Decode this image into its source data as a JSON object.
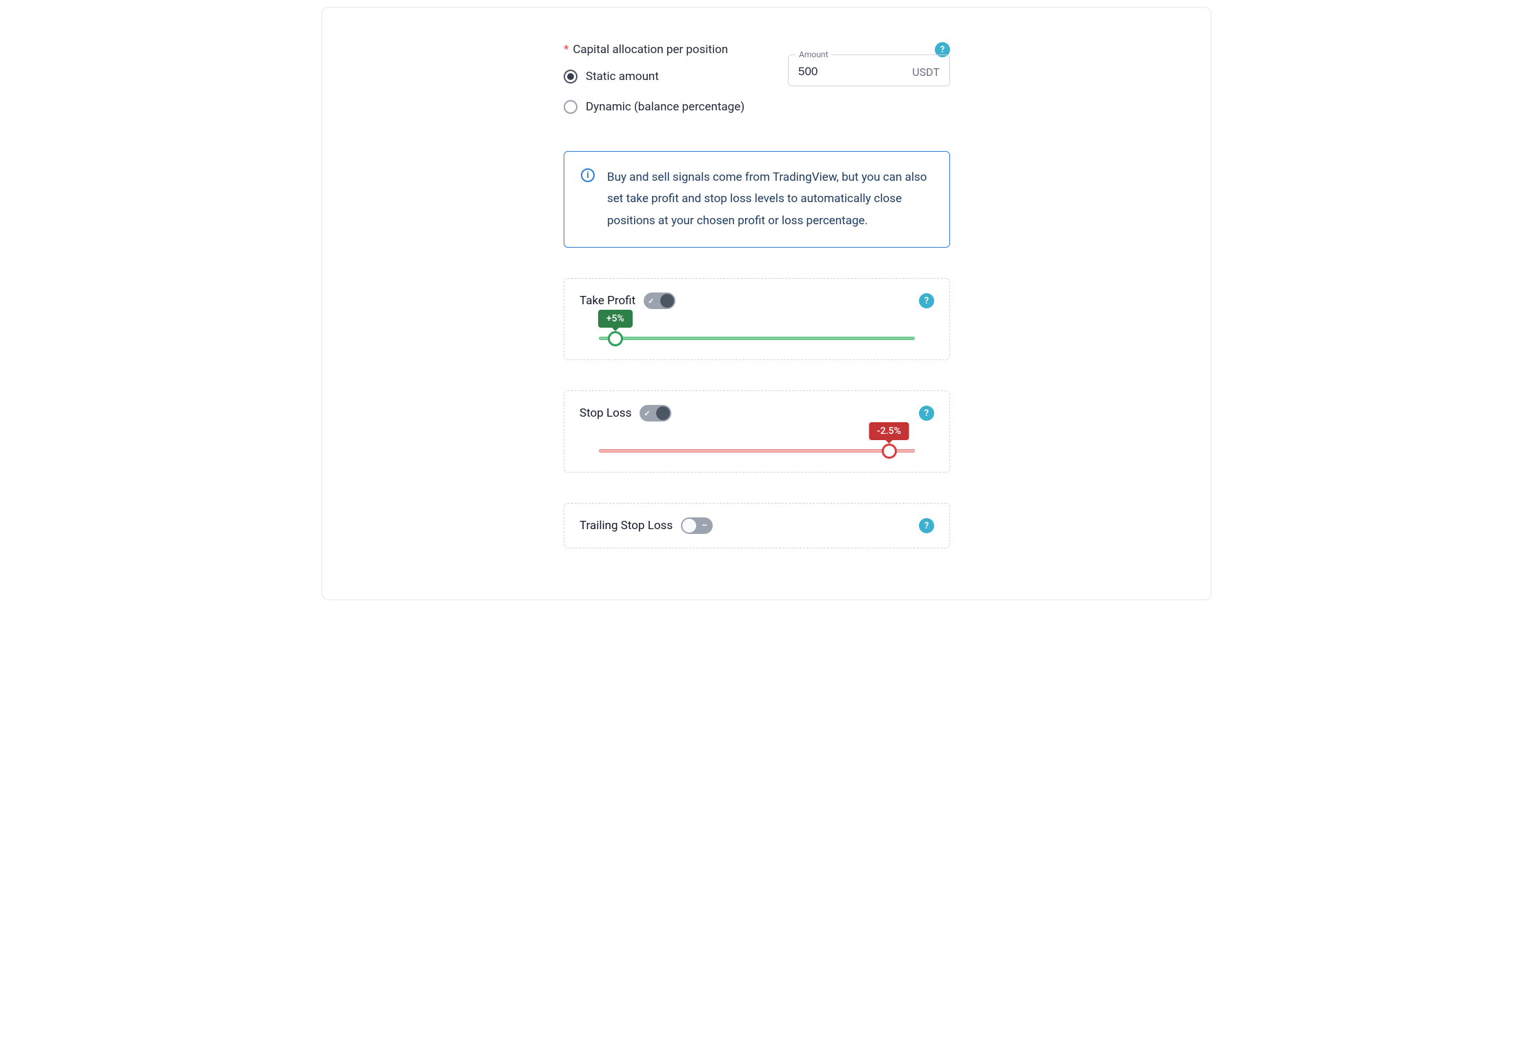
{
  "capital": {
    "title": "Capital allocation per position",
    "options": {
      "static": "Static amount",
      "dynamic": "Dynamic (balance percentage)"
    },
    "amount_label": "Amount",
    "amount_value": "500",
    "currency": "USDT"
  },
  "info": {
    "text": "Buy and sell signals come from TradingView, but you can also set take profit and stop loss levels to automatically close positions at your chosen profit or loss percentage."
  },
  "take_profit": {
    "title": "Take Profit",
    "value_label": "+5%",
    "handle_pct": 5
  },
  "stop_loss": {
    "title": "Stop Loss",
    "value_label": "-2.5%",
    "handle_pct": 92
  },
  "trailing": {
    "title": "Trailing Stop Loss"
  },
  "help_symbol": "?",
  "info_symbol": "i",
  "check_symbol": "✓",
  "dash_symbol": "–"
}
